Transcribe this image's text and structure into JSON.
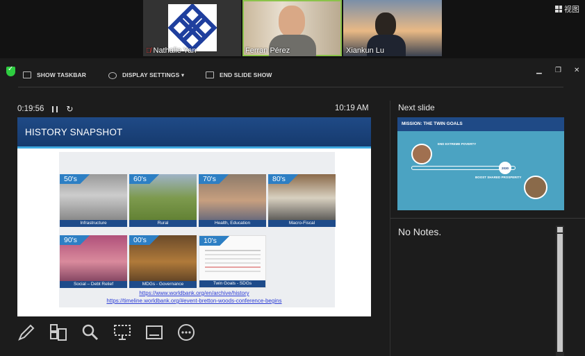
{
  "participants": [
    {
      "name": "Nathalie Yan",
      "muted": true
    },
    {
      "name": "Ferran Pérez",
      "muted": false,
      "active": true
    },
    {
      "name": "Xiankun Lu",
      "muted": false
    }
  ],
  "view_button": "视图",
  "toolbar": {
    "show_taskbar": "SHOW TASKBAR",
    "display_settings": "DISPLAY SETTINGS ▾",
    "end_slide_show": "END SLIDE SHOW"
  },
  "timer": "0:19:56",
  "clock": "10:19 AM",
  "slide": {
    "title": "HISTORY SNAPSHOT",
    "tiles": [
      {
        "decade": "50's",
        "caption": "Infrastructure"
      },
      {
        "decade": "60's",
        "caption": "Rural"
      },
      {
        "decade": "70's",
        "caption": "Health, Education"
      },
      {
        "decade": "80's",
        "caption": "Macro-Fiscal"
      },
      {
        "decade": "90's",
        "caption": "Social – Debt Relief"
      },
      {
        "decade": "00's",
        "caption": "MDGs - Governance"
      },
      {
        "decade": "10's",
        "caption": "Twin Goals - SDGs"
      }
    ],
    "links": [
      "https://www.worldbank.org/en/archive/history",
      "https://timeline.worldbank.org/#event-bretton-woods-conference-begins"
    ]
  },
  "next_slide": {
    "label": "Next slide",
    "title": "MISSION: THE TWIN GOALS",
    "goal1": "END EXTREME POVERTY",
    "goal2": "BOOST SHARED PROSPERITY",
    "badge": "2030"
  },
  "notes": "No Notes.",
  "tools": [
    "pen-tool",
    "slide-grid",
    "zoom",
    "black-screen",
    "subtitles",
    "more-options"
  ]
}
